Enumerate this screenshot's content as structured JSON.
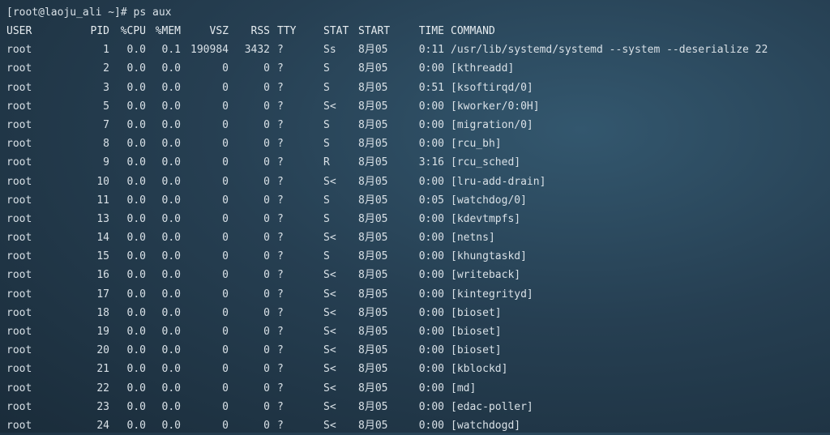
{
  "terminal": {
    "prompt": "[root@laoju_ali ~]# ps aux",
    "headers": [
      "USER",
      "PID",
      "%CPU",
      "%MEM",
      "VSZ",
      "RSS",
      "TTY",
      "STAT",
      "START",
      "TIME",
      "COMMAND"
    ],
    "rows": [
      [
        "root",
        "1",
        "0.0",
        "0.1",
        "190984",
        "3432",
        "?",
        "Ss",
        "8月05",
        "0:11",
        "/usr/lib/systemd/systemd --system --deserialize 22"
      ],
      [
        "root",
        "2",
        "0.0",
        "0.0",
        "0",
        "0",
        "?",
        "S",
        "8月05",
        "0:00",
        "[kthreadd]"
      ],
      [
        "root",
        "3",
        "0.0",
        "0.0",
        "0",
        "0",
        "?",
        "S",
        "8月05",
        "0:51",
        "[ksoftirqd/0]"
      ],
      [
        "root",
        "5",
        "0.0",
        "0.0",
        "0",
        "0",
        "?",
        "S<",
        "8月05",
        "0:00",
        "[kworker/0:0H]"
      ],
      [
        "root",
        "7",
        "0.0",
        "0.0",
        "0",
        "0",
        "?",
        "S",
        "8月05",
        "0:00",
        "[migration/0]"
      ],
      [
        "root",
        "8",
        "0.0",
        "0.0",
        "0",
        "0",
        "?",
        "S",
        "8月05",
        "0:00",
        "[rcu_bh]"
      ],
      [
        "root",
        "9",
        "0.0",
        "0.0",
        "0",
        "0",
        "?",
        "R",
        "8月05",
        "3:16",
        "[rcu_sched]"
      ],
      [
        "root",
        "10",
        "0.0",
        "0.0",
        "0",
        "0",
        "?",
        "S<",
        "8月05",
        "0:00",
        "[lru-add-drain]"
      ],
      [
        "root",
        "11",
        "0.0",
        "0.0",
        "0",
        "0",
        "?",
        "S",
        "8月05",
        "0:05",
        "[watchdog/0]"
      ],
      [
        "root",
        "13",
        "0.0",
        "0.0",
        "0",
        "0",
        "?",
        "S",
        "8月05",
        "0:00",
        "[kdevtmpfs]"
      ],
      [
        "root",
        "14",
        "0.0",
        "0.0",
        "0",
        "0",
        "?",
        "S<",
        "8月05",
        "0:00",
        "[netns]"
      ],
      [
        "root",
        "15",
        "0.0",
        "0.0",
        "0",
        "0",
        "?",
        "S",
        "8月05",
        "0:00",
        "[khungtaskd]"
      ],
      [
        "root",
        "16",
        "0.0",
        "0.0",
        "0",
        "0",
        "?",
        "S<",
        "8月05",
        "0:00",
        "[writeback]"
      ],
      [
        "root",
        "17",
        "0.0",
        "0.0",
        "0",
        "0",
        "?",
        "S<",
        "8月05",
        "0:00",
        "[kintegrityd]"
      ],
      [
        "root",
        "18",
        "0.0",
        "0.0",
        "0",
        "0",
        "?",
        "S<",
        "8月05",
        "0:00",
        "[bioset]"
      ],
      [
        "root",
        "19",
        "0.0",
        "0.0",
        "0",
        "0",
        "?",
        "S<",
        "8月05",
        "0:00",
        "[bioset]"
      ],
      [
        "root",
        "20",
        "0.0",
        "0.0",
        "0",
        "0",
        "?",
        "S<",
        "8月05",
        "0:00",
        "[bioset]"
      ],
      [
        "root",
        "21",
        "0.0",
        "0.0",
        "0",
        "0",
        "?",
        "S<",
        "8月05",
        "0:00",
        "[kblockd]"
      ],
      [
        "root",
        "22",
        "0.0",
        "0.0",
        "0",
        "0",
        "?",
        "S<",
        "8月05",
        "0:00",
        "[md]"
      ],
      [
        "root",
        "23",
        "0.0",
        "0.0",
        "0",
        "0",
        "?",
        "S<",
        "8月05",
        "0:00",
        "[edac-poller]"
      ],
      [
        "root",
        "24",
        "0.0",
        "0.0",
        "0",
        "0",
        "?",
        "S<",
        "8月05",
        "0:00",
        "[watchdogd]"
      ]
    ]
  }
}
